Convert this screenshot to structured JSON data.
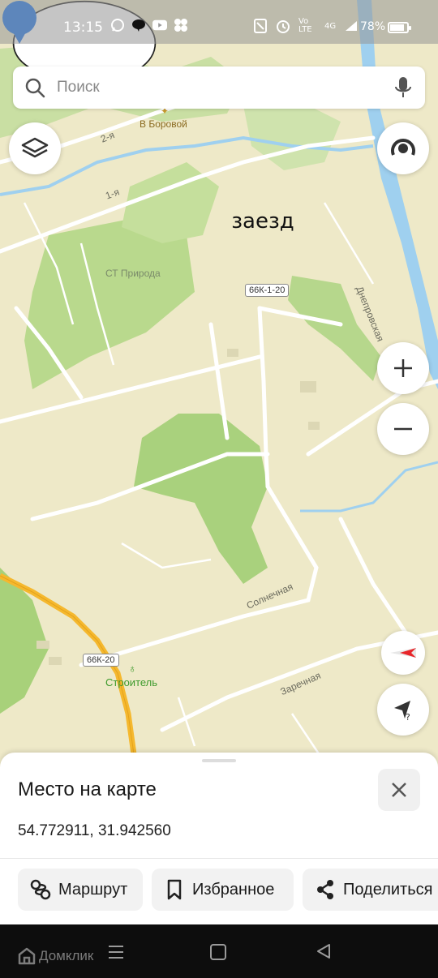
{
  "status_bar": {
    "time": "13:15",
    "network_label": "Vo LTE",
    "signal_label": "4G",
    "battery_percent": "78%"
  },
  "search": {
    "placeholder": "Поиск"
  },
  "map": {
    "labels": {
      "v_borovoy": "В Боровой",
      "st_priroda": "СТ Природа",
      "street_2ya": "2-я",
      "street_1ya": "1-я",
      "dneprovskaya": "Днепровская",
      "solnechnaya": "Солнечная",
      "zarechnaya": "Заречная",
      "stroitel": "Строитель",
      "road_top": "66К-1-20",
      "road_bottom": "66К-20"
    },
    "marker_note": "заезд"
  },
  "colors": {
    "map_base": "#eee9c8",
    "park": "#c6dd9a",
    "forest": "#a8d17a",
    "river": "#9fd0ef",
    "pin": "#1a73e8",
    "highway": "#f5b82e",
    "stroitel_label": "#3d9a2c"
  },
  "sheet": {
    "title": "Место на карте",
    "coordinates": "54.772911, 31.942560",
    "actions": {
      "route": "Маршрут",
      "favorites": "Избранное",
      "share": "Поделиться"
    }
  },
  "nav_bar": {
    "brand": "Домклик"
  },
  "icons": [
    "search-icon",
    "mic-icon",
    "layers-icon",
    "compass-icon",
    "zoom-in-icon",
    "zoom-out-icon",
    "north-arrow-icon",
    "my-location-icon",
    "close-icon",
    "route-icon",
    "bookmark-icon",
    "share-icon"
  ]
}
